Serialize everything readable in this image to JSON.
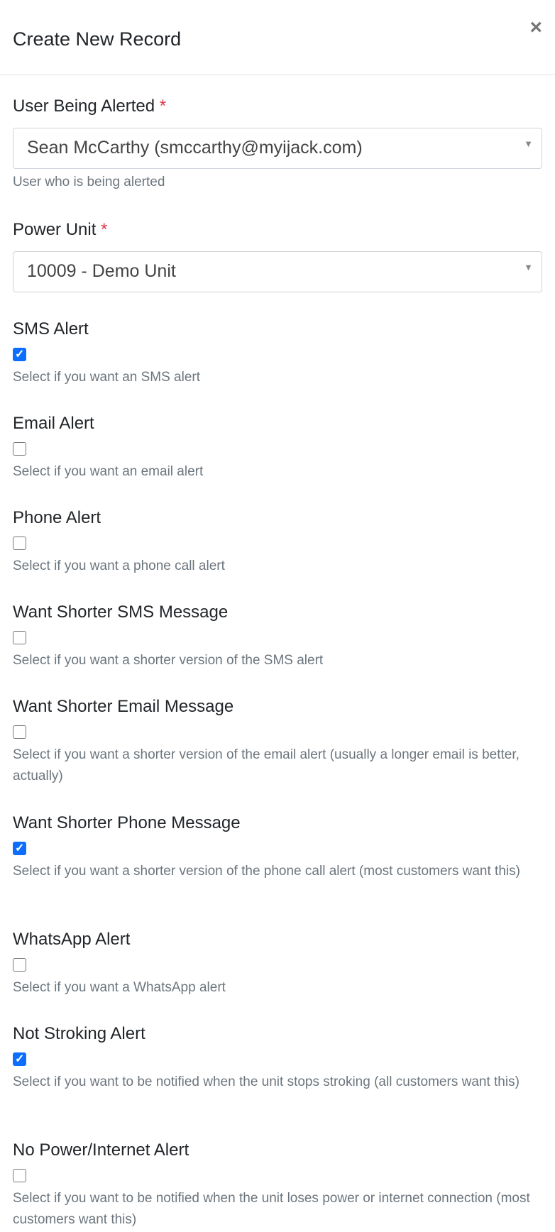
{
  "modal": {
    "title": "Create New Record",
    "close_label": "×"
  },
  "fields": {
    "user": {
      "label": "User Being Alerted",
      "required_mark": "*",
      "value": "Sean McCarthy (smccarthy@myijack.com)",
      "arrow": "▼",
      "help": "User who is being alerted"
    },
    "power_unit": {
      "label": "Power Unit",
      "required_mark": "*",
      "value": "10009 - Demo Unit",
      "arrow": "▼"
    }
  },
  "checkboxes": [
    {
      "label": "SMS Alert",
      "checked": true,
      "help": "Select if you want an SMS alert"
    },
    {
      "label": "Email Alert",
      "checked": false,
      "help": "Select if you want an email alert"
    },
    {
      "label": "Phone Alert",
      "checked": false,
      "help": "Select if you want a phone call alert"
    },
    {
      "label": "Want Shorter SMS Message",
      "checked": false,
      "help": "Select if you want a shorter version of the SMS alert"
    },
    {
      "label": "Want Shorter Email Message",
      "checked": false,
      "help": "Select if you want a shorter version of the email alert (usually a longer email is better, actually)"
    },
    {
      "label": "Want Shorter Phone Message",
      "checked": true,
      "help": "Select if you want a shorter version of the phone call alert (most customers want this)"
    },
    {
      "label": "WhatsApp Alert",
      "checked": false,
      "help": "Select if you want a WhatsApp alert"
    },
    {
      "label": "Not Stroking Alert",
      "checked": true,
      "help": "Select if you want to be notified when the unit stops stroking (all customers want this)"
    },
    {
      "label": "No Power/Internet Alert",
      "checked": false,
      "help": "Select if you want to be notified when the unit loses power or internet connection (most customers want this)"
    }
  ]
}
